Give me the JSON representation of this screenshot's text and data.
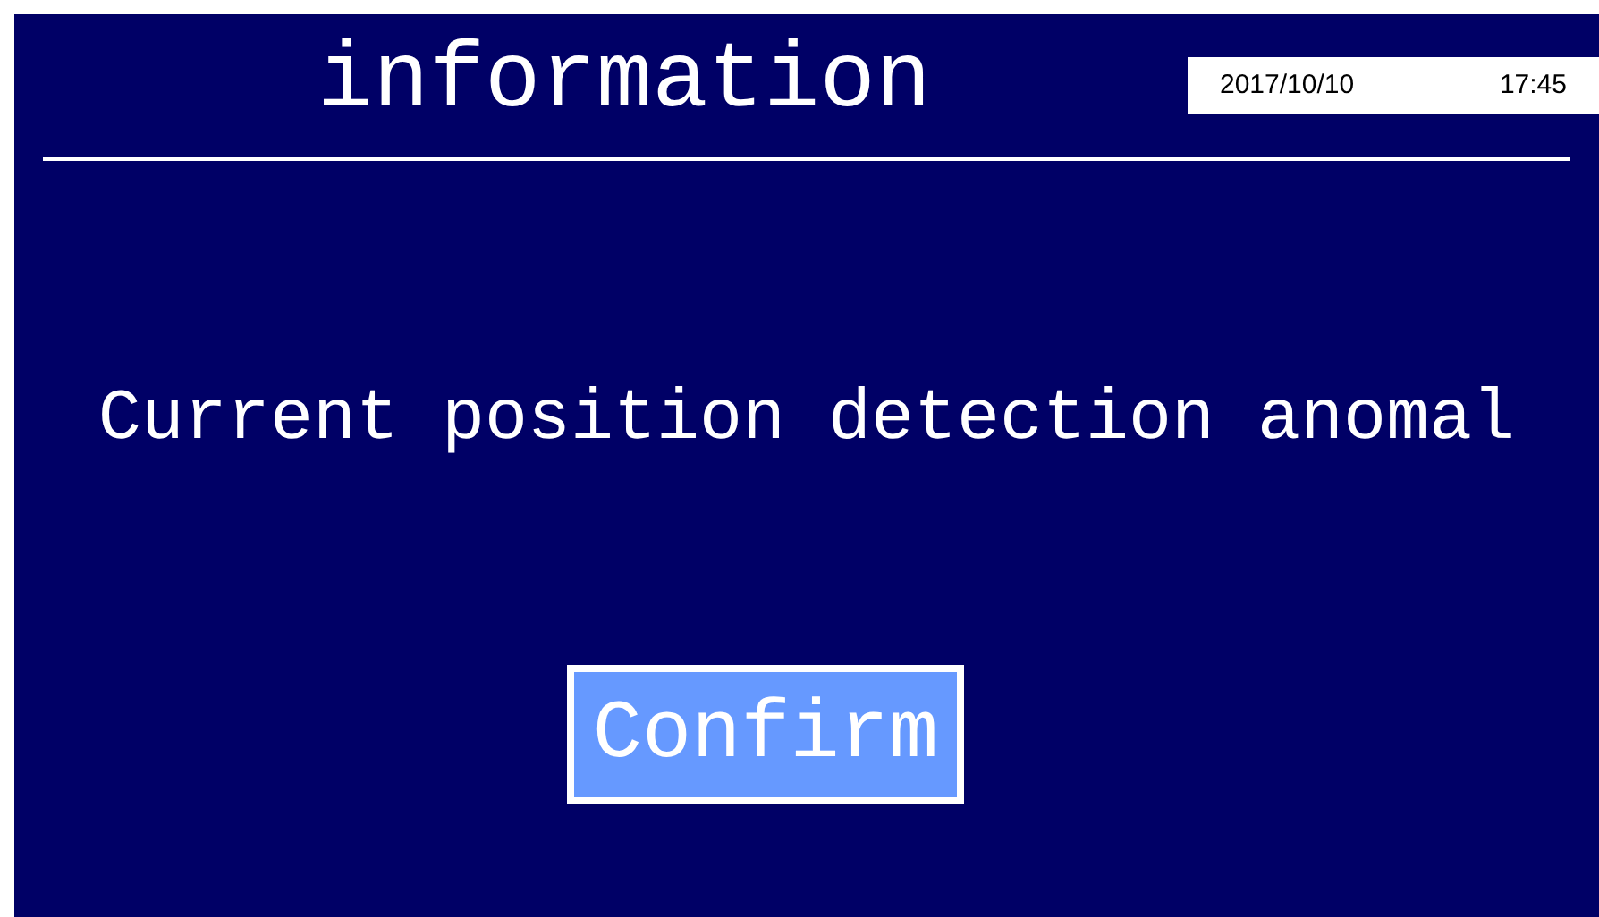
{
  "header": {
    "title": "information",
    "date": "2017/10/10",
    "time": "17:45"
  },
  "message": "Current position detection anomal",
  "buttons": [
    "Confirm"
  ]
}
